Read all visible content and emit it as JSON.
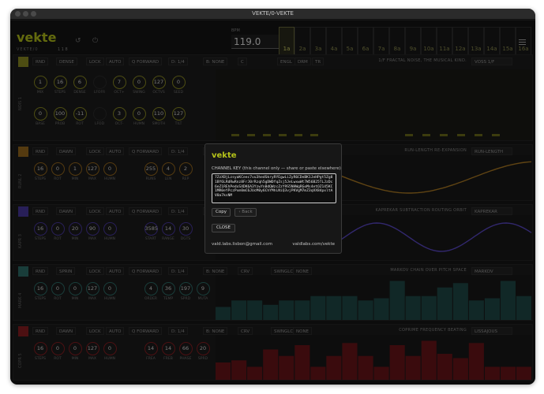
{
  "window": {
    "title": "VEKTE/0-VEKTE"
  },
  "header": {
    "logo_text": "vekte",
    "version": "VEKTE/0",
    "num": "1 1 8",
    "bpm_label": "BPM",
    "bpm": "119.0",
    "steps": [
      "1a",
      "2a",
      "3a",
      "4a",
      "5a",
      "6a",
      "7a",
      "8a",
      "9a",
      "10a",
      "11a",
      "12a",
      "13a",
      "14a",
      "15a",
      "16a"
    ],
    "active_step": 0
  },
  "colors": {
    "track1": "#8c8c23",
    "track2": "#9a6a1e",
    "track3": "#4a3aa0",
    "track4": "#2f6f6a",
    "track5": "#8a1e22"
  },
  "tracks": [
    {
      "color": "#8c8c23",
      "label": "NOIS 1",
      "controls": [
        "RND",
        "DENSE",
        "LOCK",
        "AUTO",
        "Q FORWARD",
        "D: 1/4",
        "B: NONE",
        "C"
      ],
      "extra": [
        "ENGL",
        "DRM",
        "TR"
      ],
      "alg_name": "1/F FRACTAL NOISE, THE MUSICAL KIND.",
      "alg_select": "VOSS 1/F",
      "knobs": [
        {
          "v": "1",
          "l": "MIX"
        },
        {
          "v": "16",
          "l": "STEPS"
        },
        {
          "v": "6",
          "l": "DENSE"
        },
        {
          "v": "",
          "l": "LFOFR"
        },
        {
          "v": "7",
          "l": "OCT+"
        },
        {
          "v": "0",
          "l": "SWING"
        },
        {
          "v": "127",
          "l": "OCTVS"
        },
        {
          "v": "0",
          "l": "SEED"
        },
        {
          "v": "0",
          "l": "BASE"
        },
        {
          "v": "100",
          "l": "PROB"
        },
        {
          "v": "-11",
          "l": "ROT"
        },
        {
          "v": "",
          "l": "LFOD"
        },
        {
          "v": "3",
          "l": "OCT-"
        },
        {
          "v": "0",
          "l": "HUMN"
        },
        {
          "v": "110",
          "l": "SMOTH"
        },
        {
          "v": "127",
          "l": "TILT"
        }
      ]
    },
    {
      "color": "#9a6a1e",
      "label": "RUNL 2",
      "controls": [
        "RND",
        "DAWN",
        "LOCK",
        "AUTO",
        "Q FORWARD",
        "D: 1/4",
        "B: NONE"
      ],
      "alg_name": "RUN-LENGTH RE-EXPANSION",
      "alg_select": "RUN-LENGTH",
      "knobs": [
        {
          "v": "16",
          "l": "STEPS"
        },
        {
          "v": "0",
          "l": "ROT"
        },
        {
          "v": "1",
          "l": "MIN"
        },
        {
          "v": "127",
          "l": "MAX"
        },
        {
          "v": "0",
          "l": "HUMN"
        },
        {
          "v": "255",
          "l": "RUNS"
        },
        {
          "v": "4",
          "l": "LEN"
        },
        {
          "v": "2",
          "l": "REP"
        }
      ]
    },
    {
      "color": "#4a3aa0",
      "label": "KAPR 3",
      "controls": [
        "RND",
        "DAWN",
        "LOCK",
        "AUTO",
        "Q FORWARD",
        "D: 1/4",
        "B: NONE"
      ],
      "alg_name": "KAPREKAR SUBTRACTION ROUTING ORBIT",
      "alg_select": "KAPREKAR",
      "knobs": [
        {
          "v": "16",
          "l": "STEPS"
        },
        {
          "v": "0",
          "l": "ROT"
        },
        {
          "v": "20",
          "l": "MIN"
        },
        {
          "v": "90",
          "l": "MAX"
        },
        {
          "v": "0",
          "l": "HUMN"
        },
        {
          "v": "3585",
          "l": "START"
        },
        {
          "v": "14",
          "l": "RANGE"
        },
        {
          "v": "30",
          "l": "DGTS"
        }
      ]
    },
    {
      "color": "#2f6f6a",
      "label": "MARK 4",
      "controls": [
        "RND",
        "SPRIN",
        "LOCK",
        "AUTO",
        "Q FORWARD",
        "D: 1/4",
        "B: NONE",
        "CRV",
        "SWNGLCK",
        "NONE"
      ],
      "alg_name": "MARKOV CHAIN OVER PITCH SPACE",
      "alg_select": "MARKOV",
      "knobs": [
        {
          "v": "16",
          "l": "STEPS"
        },
        {
          "v": "0",
          "l": "ROT"
        },
        {
          "v": "0",
          "l": "MIN"
        },
        {
          "v": "127",
          "l": "MAX"
        },
        {
          "v": "0",
          "l": "HUMN"
        },
        {
          "v": "4",
          "l": "ORDER"
        },
        {
          "v": "36",
          "l": "TEMP"
        },
        {
          "v": "197",
          "l": "SPRD"
        },
        {
          "v": "9",
          "l": "MUTA"
        }
      ],
      "bars": [
        0.3,
        0.45,
        0.45,
        0.35,
        0.45,
        0.45,
        0.55,
        0.55,
        0.55,
        0.45,
        0.5,
        0.9,
        0.55,
        0.55,
        0.75,
        0.85,
        0.45,
        0.5,
        0.9,
        0.55
      ]
    },
    {
      "color": "#8a1e22",
      "label": "COPR 5",
      "controls": [
        "RND",
        "DAWN",
        "LOCK",
        "AUTO",
        "Q FORWARD",
        "D: 1/4",
        "B: NONE",
        "CRV",
        "SWNGLCK",
        "NONE"
      ],
      "alg_name": "COPRIME FREQUENCY BEATING",
      "alg_select": "LISSAJOUS",
      "knobs": [
        {
          "v": "16",
          "l": "STEPS"
        },
        {
          "v": "0",
          "l": "ROT"
        },
        {
          "v": "0",
          "l": "MIN"
        },
        {
          "v": "127",
          "l": "MAX"
        },
        {
          "v": "0",
          "l": "HUMN"
        },
        {
          "v": "14",
          "l": "FREA"
        },
        {
          "v": "14",
          "l": "FREB"
        },
        {
          "v": "66",
          "l": "PHASE"
        },
        {
          "v": "20",
          "l": "SPRD"
        }
      ],
      "bars": [
        0.4,
        0.45,
        0.3,
        0.7,
        0.55,
        0.8,
        0.3,
        0.55,
        0.85,
        0.55,
        0.3,
        0.8,
        0.55,
        0.9,
        0.6,
        0.5,
        0.85,
        0.3,
        0.3,
        0.3
      ]
    }
  ],
  "dialog": {
    "logo_text": "vekte",
    "title": "CHANNEL KEY (this channel only — share or paste elsewhere)",
    "key": "7ZzXBjLzsyaKCeec7vu3hedSkryRYEgwLiZyR6CDeBK1JeHPgt5Zg81BY6LRdRwRnz8FrJ0rRzqh5gDWDfqZsj5JeLwxwWt7W56B25TLJzDc6eZ1REhPedxSXDK6A3YzwYnBdQWzcZzY9S5NHWgRGoMs4etOZ145KC1MR0eYPczPxm0mC6JUcM0y6ChYMhLNiQ3vjPKVgM7mZ3qVX84pxltAV0a7ksNM",
    "copy_label": "Copy",
    "back_label": "‹ Back",
    "close_label": "CLOSE",
    "email": "vald.labs.lisbon@gmail.com",
    "site": "valdlabs.com/vekte"
  }
}
